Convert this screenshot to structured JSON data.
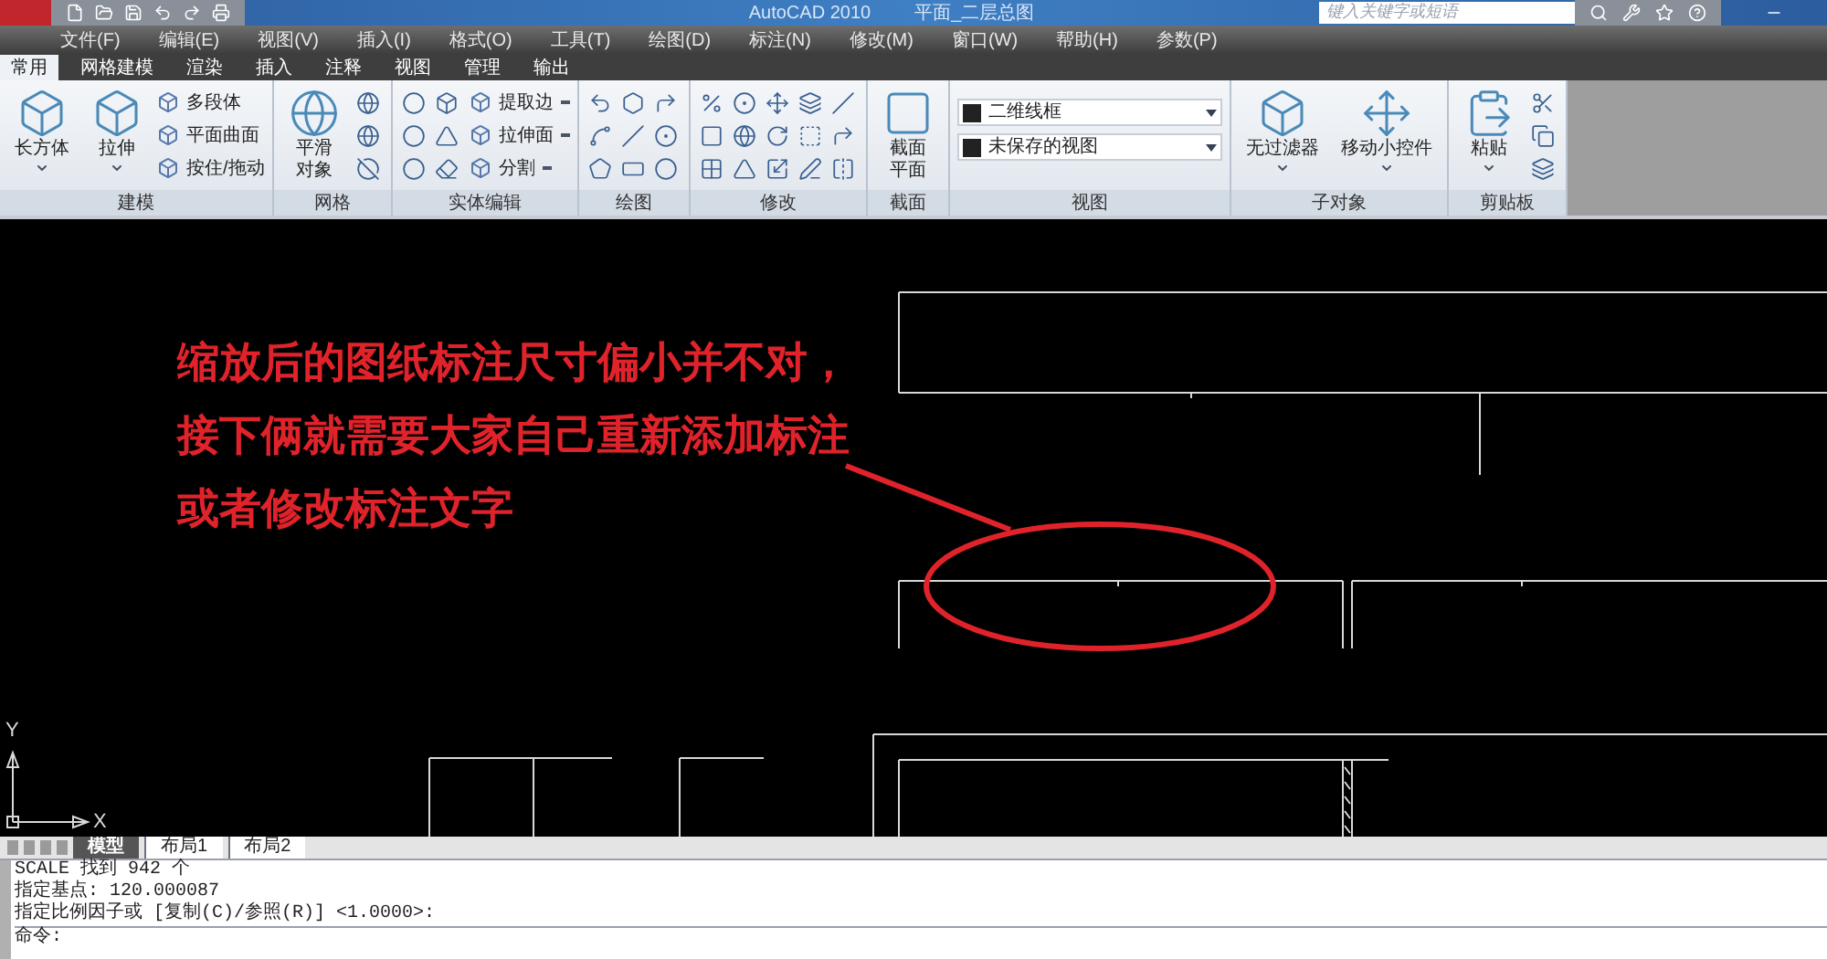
{
  "title_bar": {
    "app_title": "AutoCAD 2010",
    "document_title": "平面_二层总图",
    "search": {
      "placeholder": "键入关键字或短语"
    }
  },
  "menu": [
    "文件(F)",
    "编辑(E)",
    "视图(V)",
    "插入(I)",
    "格式(O)",
    "工具(T)",
    "绘图(D)",
    "标注(N)",
    "修改(M)",
    "窗口(W)",
    "帮助(H)",
    "参数(P)"
  ],
  "ribbon_tabs": [
    {
      "label": "常用",
      "selected": true
    },
    {
      "label": "网格建模",
      "selected": false
    },
    {
      "label": "渲染",
      "selected": false
    },
    {
      "label": "插入",
      "selected": false
    },
    {
      "label": "注释",
      "selected": false
    },
    {
      "label": "视图",
      "selected": false
    },
    {
      "label": "管理",
      "selected": false
    },
    {
      "label": "输出",
      "selected": false
    }
  ],
  "panels": [
    {
      "title": "建模",
      "kind": "modeling",
      "items": [
        {
          "kind": "large",
          "label": "长方体",
          "has_menu": true
        },
        {
          "kind": "large",
          "label": "拉伸",
          "has_menu": true
        },
        {
          "kind": "small_stack",
          "tools": [
            {
              "label": "多段体",
              "has_menu": false
            },
            {
              "label": "平面曲面",
              "has_menu": false
            },
            {
              "label": "按住/拖动",
              "has_menu": false
            }
          ]
        }
      ]
    },
    {
      "title": "网格",
      "kind": "mesh",
      "items": [
        {
          "kind": "large",
          "label": "平滑对象",
          "has_menu": false
        },
        {
          "kind": "icon_grid"
        }
      ]
    },
    {
      "title": "实体编辑",
      "kind": "solid_edit",
      "items": [
        {
          "kind": "icon_grid"
        },
        {
          "kind": "small_stack",
          "tools": [
            {
              "label": "提取边",
              "has_menu": true
            },
            {
              "label": "拉伸面",
              "has_menu": true
            },
            {
              "label": "分割",
              "has_menu": true
            }
          ]
        }
      ]
    },
    {
      "title": "绘图",
      "kind": "draw",
      "items": [
        {
          "kind": "icon_grid"
        }
      ]
    },
    {
      "title": "修改",
      "kind": "modify",
      "items": [
        {
          "kind": "icon_grid"
        }
      ]
    },
    {
      "title": "截面",
      "kind": "section",
      "items": [
        {
          "kind": "large",
          "label": "截面平面",
          "has_menu": false
        }
      ]
    },
    {
      "title": "视图",
      "kind": "view",
      "items": [
        {
          "kind": "combos",
          "tools": [
            {
              "label": "二维线框"
            },
            {
              "label": "未保存的视图"
            }
          ]
        }
      ]
    },
    {
      "title": "子对象",
      "kind": "subobject",
      "items": [
        {
          "kind": "large",
          "label": "无过滤器",
          "has_menu": true
        },
        {
          "kind": "large",
          "label": "移动小控件",
          "has_menu": true
        }
      ]
    },
    {
      "title": "剪贴板",
      "kind": "clipboard",
      "items": [
        {
          "kind": "large",
          "label": "粘贴",
          "has_menu": true
        },
        {
          "kind": "icon_grid"
        }
      ]
    }
  ],
  "annotation": {
    "lines": [
      "缩放后的图纸标注尺寸偏小并不对，",
      "接下俩就需要大家自己重新添加标注",
      "或者修改标注文字"
    ]
  },
  "ucs": {
    "x_label": "X",
    "y_label": "Y"
  },
  "layout_tabs": [
    {
      "label": "模型",
      "selected": true
    },
    {
      "label": "布局1",
      "selected": false
    },
    {
      "label": "布局2",
      "selected": false
    }
  ],
  "command_history": [
    "SCALE 找到 942 个",
    "指定基点: 120.000087",
    "指定比例因子或 [复制(C)/参照(R)] <1.0000>:"
  ],
  "command_prompt": "命令:"
}
